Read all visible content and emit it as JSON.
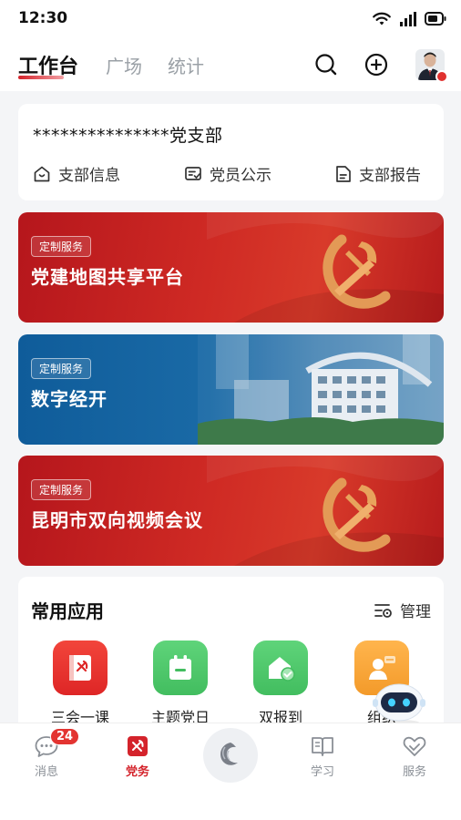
{
  "status_bar": {
    "time": "12:30"
  },
  "header": {
    "tabs": [
      {
        "label": "工作台",
        "active": true
      },
      {
        "label": "广场",
        "active": false
      },
      {
        "label": "统计",
        "active": false
      }
    ],
    "search_icon": "search-icon",
    "add_icon": "plus-circle-icon"
  },
  "branch": {
    "name": "***************党支部",
    "links": [
      {
        "label": "支部信息",
        "icon": "house-icon"
      },
      {
        "label": "党员公示",
        "icon": "notice-icon"
      },
      {
        "label": "支部报告",
        "icon": "document-icon"
      }
    ]
  },
  "banners": [
    {
      "tag": "定制服务",
      "title": "党建地图共享平台",
      "theme": "red"
    },
    {
      "tag": "定制服务",
      "title": "数字经开",
      "theme": "blue"
    },
    {
      "tag": "定制服务",
      "title": "昆明市双向视频会议",
      "theme": "red"
    }
  ],
  "apps": {
    "title": "常用应用",
    "manage_label": "管理",
    "items": [
      {
        "label": "三会一课",
        "color": "#e8322b",
        "icon": "party-book-icon"
      },
      {
        "label": "主题党日",
        "color": "#4cc86a",
        "icon": "calendar-icon"
      },
      {
        "label": "双报到",
        "color": "#4cc86a",
        "icon": "home-check-icon"
      },
      {
        "label": "组织",
        "color": "#f6a53a",
        "icon": "people-icon"
      }
    ]
  },
  "nav": {
    "items": [
      {
        "label": "消息",
        "badge": "24",
        "active": false
      },
      {
        "label": "党务",
        "active": true
      },
      {
        "label": "学习",
        "active": false
      },
      {
        "label": "服务",
        "active": false
      }
    ]
  },
  "colors": {
    "party_red": "#d4232b",
    "accent_green": "#4cc86a",
    "accent_orange": "#f6a53a",
    "banner_blue": "#1a6aa6"
  }
}
